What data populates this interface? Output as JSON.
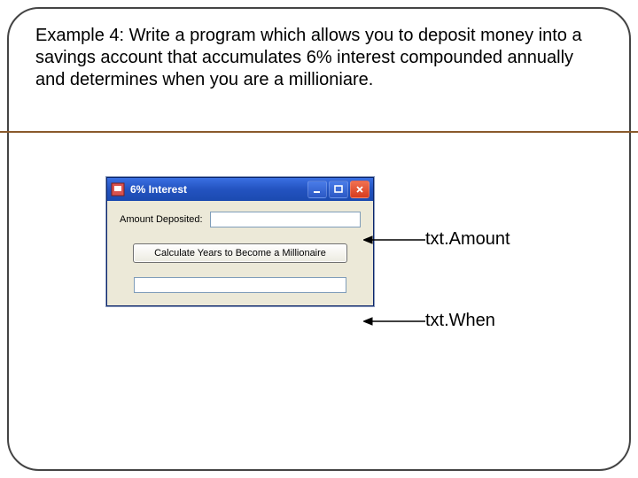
{
  "problem": {
    "text": "Example 4:  Write a program which allows you to deposit money into a savings account that accumulates 6% interest compounded annually and determines when you are a millioniare."
  },
  "window": {
    "title": "6% Interest",
    "amount_label": "Amount Deposited:",
    "button_label": "Calculate Years to Become a Millionaire"
  },
  "annotations": {
    "amount": "txt.Amount",
    "when": "txt.When"
  }
}
